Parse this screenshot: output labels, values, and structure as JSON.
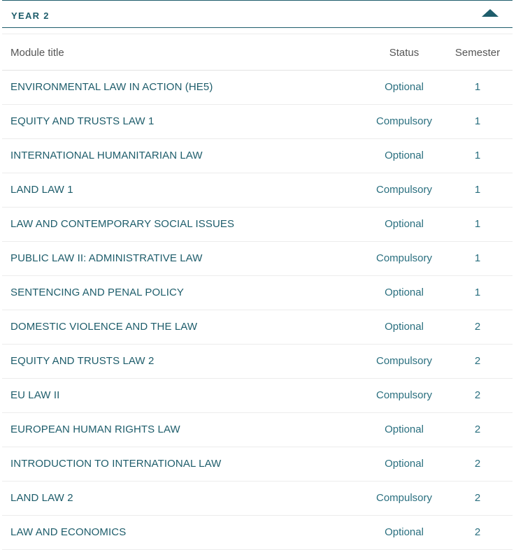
{
  "section": {
    "title": "YEAR 2"
  },
  "table": {
    "headers": {
      "title": "Module title",
      "status": "Status",
      "semester": "Semester"
    },
    "rows": [
      {
        "title": "ENVIRONMENTAL LAW IN ACTION (HE5)",
        "status": "Optional",
        "semester": "1"
      },
      {
        "title": "EQUITY AND TRUSTS LAW 1",
        "status": "Compulsory",
        "semester": "1"
      },
      {
        "title": "INTERNATIONAL HUMANITARIAN LAW",
        "status": "Optional",
        "semester": "1"
      },
      {
        "title": "LAND LAW 1",
        "status": "Compulsory",
        "semester": "1"
      },
      {
        "title": "LAW AND CONTEMPORARY SOCIAL ISSUES",
        "status": "Optional",
        "semester": "1"
      },
      {
        "title": "PUBLIC LAW II: ADMINISTRATIVE LAW",
        "status": "Compulsory",
        "semester": "1"
      },
      {
        "title": "SENTENCING AND PENAL POLICY",
        "status": "Optional",
        "semester": "1"
      },
      {
        "title": "DOMESTIC VIOLENCE AND THE LAW",
        "status": "Optional",
        "semester": "2"
      },
      {
        "title": "EQUITY AND TRUSTS LAW 2",
        "status": "Compulsory",
        "semester": "2"
      },
      {
        "title": "EU LAW II",
        "status": "Compulsory",
        "semester": "2"
      },
      {
        "title": "EUROPEAN HUMAN RIGHTS LAW",
        "status": "Optional",
        "semester": "2"
      },
      {
        "title": "INTRODUCTION TO INTERNATIONAL LAW",
        "status": "Optional",
        "semester": "2"
      },
      {
        "title": "LAND LAW 2",
        "status": "Compulsory",
        "semester": "2"
      },
      {
        "title": "LAW AND ECONOMICS",
        "status": "Optional",
        "semester": "2"
      }
    ]
  }
}
